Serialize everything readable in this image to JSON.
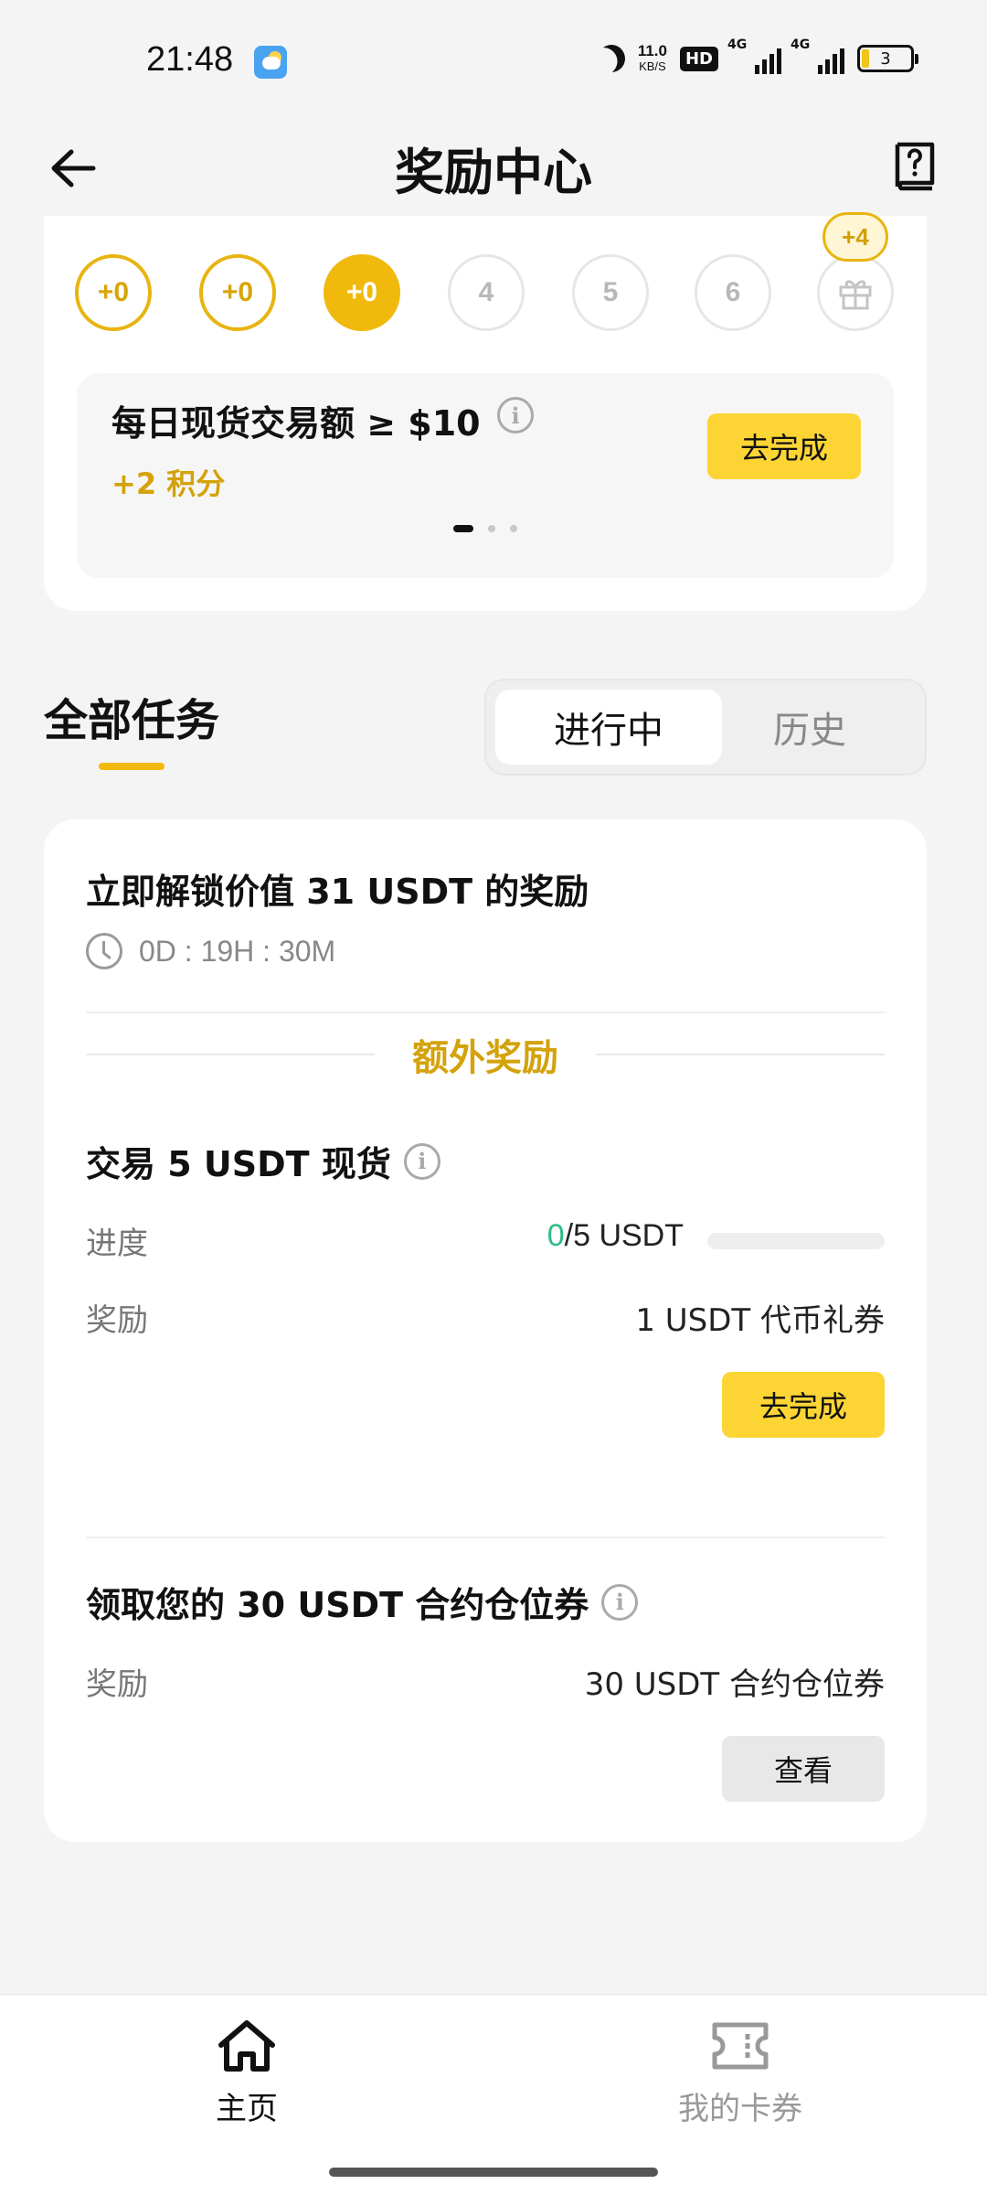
{
  "status_bar": {
    "time": "21:48",
    "net_speed_value": "11.0",
    "net_speed_unit": "KB/S",
    "hd_label": "HD",
    "signal1_label": "4G",
    "signal2_label": "4G",
    "battery_level": "3"
  },
  "header": {
    "title": "奖励中心",
    "back_icon": "arrow-left-icon",
    "help_icon": "question-book-icon"
  },
  "checkin": {
    "days": [
      {
        "label": "+0",
        "state": "done"
      },
      {
        "label": "+0",
        "state": "done"
      },
      {
        "label": "+0",
        "state": "current"
      },
      {
        "label": "4",
        "state": "future"
      },
      {
        "label": "5",
        "state": "future"
      },
      {
        "label": "6",
        "state": "future"
      }
    ],
    "gift_badge": "+4",
    "task": {
      "title": "每日现货交易额 ≥ $10",
      "points": "+2 积分",
      "button": "去完成"
    }
  },
  "all_tasks": {
    "title": "全部任务",
    "tabs": [
      {
        "label": "进行中",
        "active": true
      },
      {
        "label": "历史",
        "active": false
      }
    ]
  },
  "reward_card": {
    "title": "立即解锁价值 31 USDT 的奖励",
    "countdown": "0D : 19H : 30M",
    "extra_label": "额外奖励",
    "task1": {
      "title": "交易 5 USDT 现货",
      "progress_label": "进度",
      "progress_current": "0",
      "progress_total": "/5 USDT",
      "progress_fraction": 0,
      "reward_label": "奖励",
      "reward_value": "1 USDT 代币礼券",
      "button": "去完成"
    },
    "task2": {
      "title": "领取您的 30 USDT 合约仓位券",
      "reward_label": "奖励",
      "reward_value": "30 USDT 合约仓位券",
      "button": "查看"
    }
  },
  "bottom_nav": {
    "items": [
      {
        "label": "主页",
        "icon": "home-icon",
        "active": true
      },
      {
        "label": "我的卡券",
        "icon": "ticket-icon",
        "active": false
      }
    ]
  },
  "colors": {
    "accent": "#f0b90b",
    "button_yellow": "#fcd535",
    "gold_text": "#d4a20b",
    "progress_green": "#2ebd85"
  }
}
